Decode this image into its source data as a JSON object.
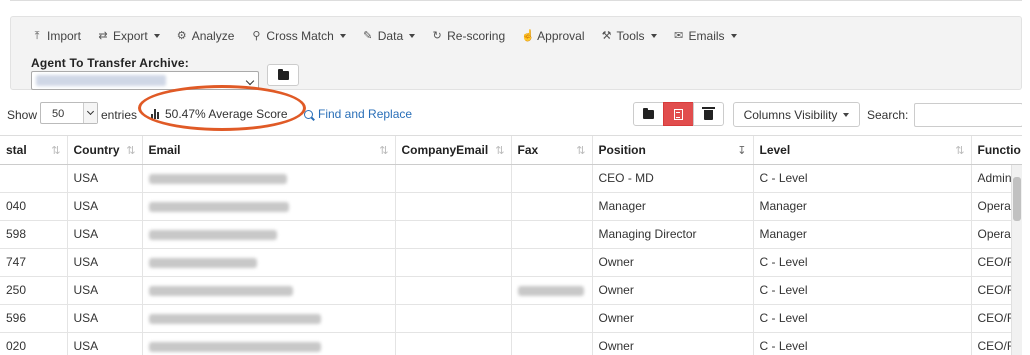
{
  "toolbar": {
    "items": [
      {
        "label": "Import",
        "icon": "upload-icon",
        "dropdown": false
      },
      {
        "label": "Export",
        "icon": "export-arrows-icon",
        "dropdown": true
      },
      {
        "label": "Analyze",
        "icon": "gear-icon",
        "dropdown": false
      },
      {
        "label": "Cross Match",
        "icon": "search-icon",
        "dropdown": true
      },
      {
        "label": "Data",
        "icon": "pencil-icon",
        "dropdown": true
      },
      {
        "label": "Re-scoring",
        "icon": "refresh-icon",
        "dropdown": false
      },
      {
        "label": "Approval",
        "icon": "thumbs-up-icon",
        "dropdown": false
      },
      {
        "label": "Tools",
        "icon": "tools-icon",
        "dropdown": true
      },
      {
        "label": "Emails",
        "icon": "envelope-icon",
        "dropdown": true
      }
    ],
    "archive_label": "Agent To Transfer Archive:"
  },
  "controls": {
    "show_label": "Show",
    "entries_value": "50",
    "entries_label": "entries",
    "average_score": "50.47% Average Score",
    "find_replace": "Find and Replace",
    "columns_visibility": "Columns Visibility",
    "search_label": "Search:",
    "search_value": ""
  },
  "highlight_color": "#e05a26",
  "table": {
    "columns": [
      "stal",
      "Country",
      "Email",
      "CompanyEmail",
      "Fax",
      "Position",
      "Level",
      "Functio"
    ],
    "rows": [
      {
        "postal": "",
        "country": "USA",
        "position": "CEO - MD",
        "level": "C - Level",
        "function": "Admin"
      },
      {
        "postal": "040",
        "country": "USA",
        "position": "Manager",
        "level": "Manager",
        "function": "Opera"
      },
      {
        "postal": "598",
        "country": "USA",
        "position": "Managing Director",
        "level": "Manager",
        "function": "Opera"
      },
      {
        "postal": "747",
        "country": "USA",
        "position": "Owner",
        "level": "C - Level",
        "function": "CEO/F"
      },
      {
        "postal": "250",
        "country": "USA",
        "position": "Owner",
        "level": "C - Level",
        "function": "CEO/F"
      },
      {
        "postal": "596",
        "country": "USA",
        "position": "Owner",
        "level": "C - Level",
        "function": "CEO/F"
      },
      {
        "postal": "020",
        "country": "USA",
        "position": "Owner",
        "level": "C - Level",
        "function": "CEO/F"
      }
    ]
  }
}
